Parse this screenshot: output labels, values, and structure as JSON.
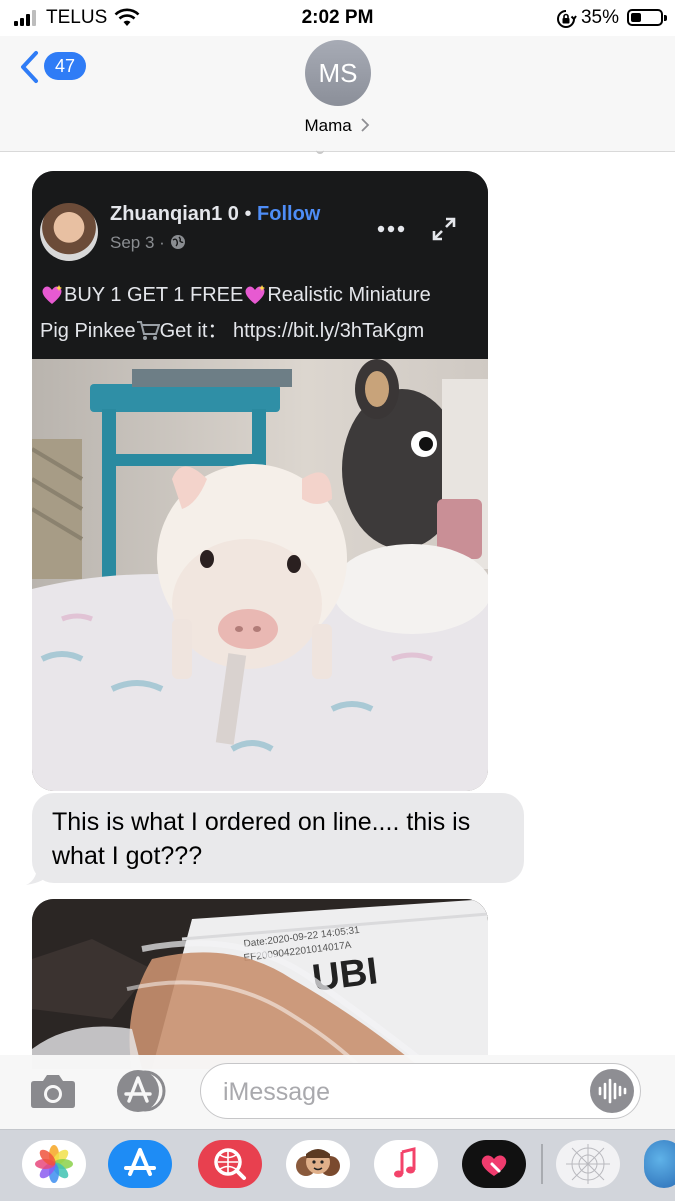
{
  "status_bar": {
    "carrier": "TELUS",
    "time": "2:02 PM",
    "battery_percent": "35%",
    "battery_level": 0.35,
    "signal_bars": 3
  },
  "header": {
    "back_badge": "47",
    "avatar_initials": "MS",
    "contact_name": "Mama",
    "back_icon": "chevron-left-icon",
    "disclosure_icon": "chevron-right-icon"
  },
  "messages": {
    "fb_post": {
      "author": "Zhuanqian1 0",
      "separator": "•",
      "follow": "Follow",
      "date": "Sep 3 ·",
      "text_line1": "BUY 1 GET 1 FREE",
      "text_line1b": "Realistic Miniature",
      "text_line2": "Pig Pinkee",
      "text_line2b": "Get it：",
      "link": "https://bit.ly/3hTaKgm"
    },
    "text_bubble": "This is what I ordered on line....  this is what I got???",
    "second_image": {
      "label_date": "Date:2020-09-22 14:05:31",
      "label_code": "EF2009042201014017A",
      "label_brand": "UBI"
    }
  },
  "input_bar": {
    "placeholder": "iMessage"
  },
  "app_drawer": {
    "apps": [
      "photos",
      "app-store",
      "web-images",
      "memoji",
      "music",
      "digital-touch",
      "more-apps",
      "world"
    ]
  },
  "colors": {
    "accent": "#2f7cf6",
    "fb_follow": "#4e8df7",
    "bubble_grey": "#e9e9eb",
    "post_bg": "#18191a"
  }
}
